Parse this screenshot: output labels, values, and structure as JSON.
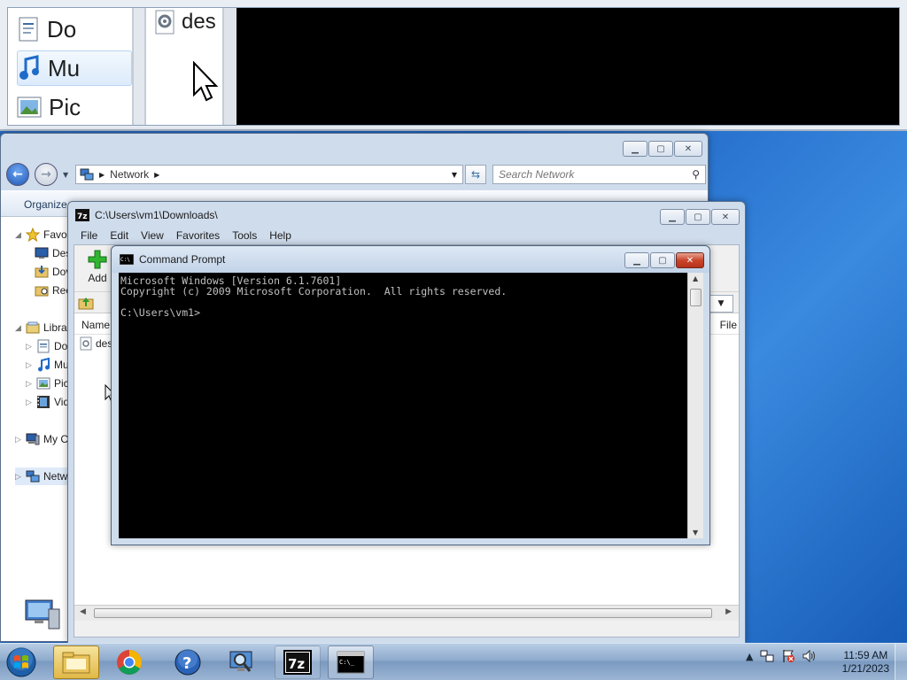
{
  "magnifier": {
    "nav_items": [
      {
        "label": "Do",
        "icon": "document-icon"
      },
      {
        "label": "Mu",
        "icon": "music-icon"
      },
      {
        "label": "Pic",
        "icon": "pictures-icon"
      }
    ],
    "mid_label": "des"
  },
  "network_window": {
    "address": "Network",
    "search_placeholder": "Search Network",
    "organize_label": "Organize",
    "tree": {
      "favorites": "Favo",
      "desktop": "Des",
      "downloads": "Dov",
      "recent": "Rec",
      "libraries": "Libra",
      "documents": "Do",
      "music": "Mu",
      "pictures": "Pic",
      "videos": "Vid",
      "computer": "My C",
      "network": "Netw"
    }
  },
  "zip_window": {
    "title": "C:\\Users\\vm1\\Downloads\\",
    "menu": [
      "File",
      "Edit",
      "View",
      "Favorites",
      "Tools",
      "Help"
    ],
    "add_label": "Add",
    "col_name": "Name",
    "col_file": "File",
    "row_name": "des"
  },
  "cmd_window": {
    "title": "Command Prompt",
    "lines": [
      "Microsoft Windows [Version 6.1.7601]",
      "Copyright (c) 2009 Microsoft Corporation.  All rights reserved.",
      "",
      "C:\\Users\\vm1>"
    ]
  },
  "taskbar": {
    "time": "11:59 AM",
    "date": "1/21/2023",
    "apps": [
      "explorer",
      "chrome",
      "help",
      "magnifier",
      "7-zip",
      "command-prompt"
    ],
    "seven_zip_label": "7z"
  },
  "colors": {
    "desktop": "#1a5fc0",
    "close_red": "#c8452c"
  }
}
